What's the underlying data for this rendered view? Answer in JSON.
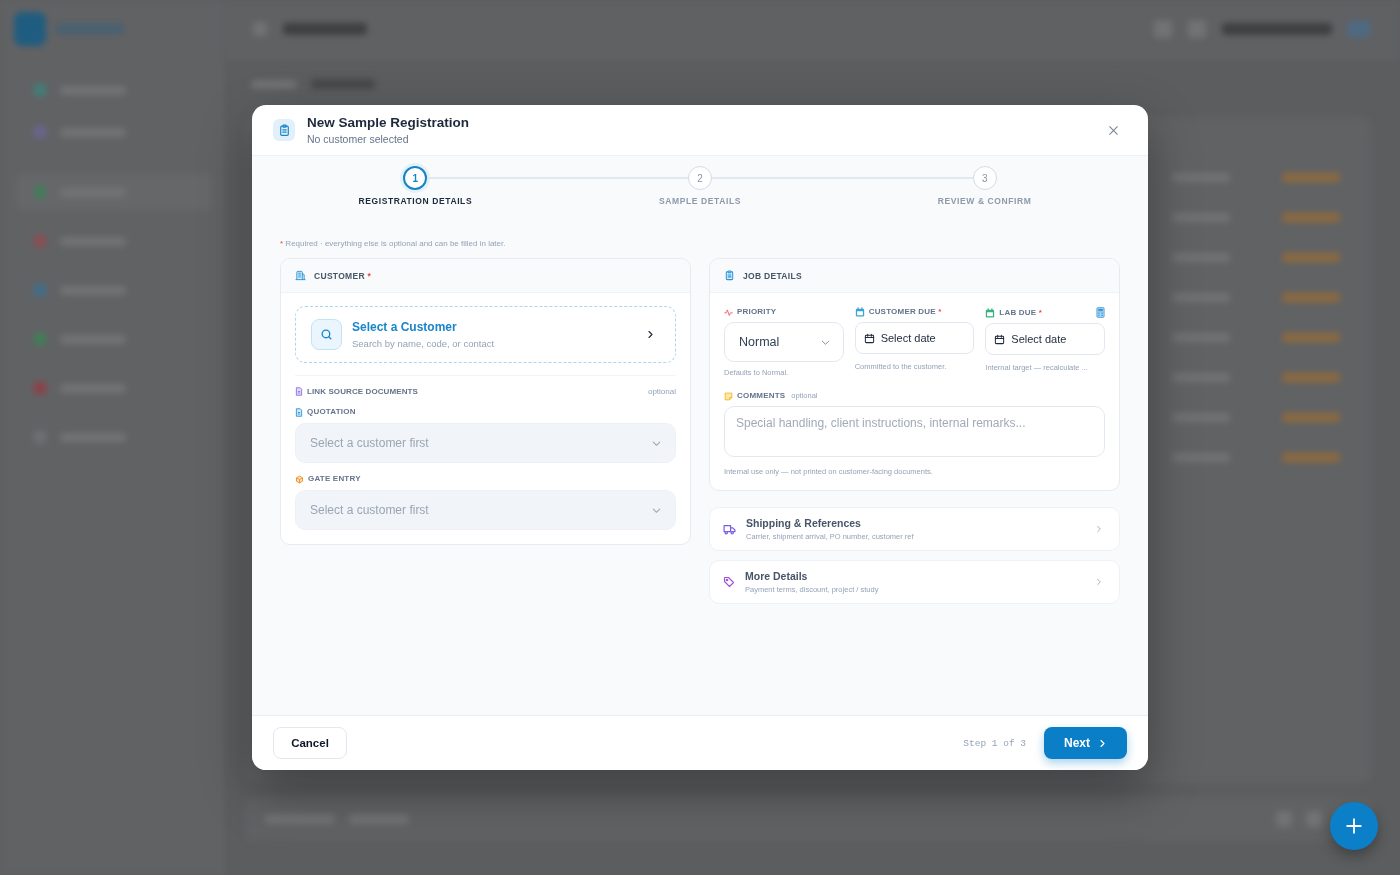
{
  "dialog": {
    "title": "New Sample Registration",
    "subtitle": "No customer selected"
  },
  "steps": [
    {
      "number": "1",
      "label": "REGISTRATION DETAILS",
      "selected": true
    },
    {
      "number": "2",
      "label": "SAMPLE DETAILS",
      "selected": false
    },
    {
      "number": "3",
      "label": "REVIEW & CONFIRM",
      "selected": false
    }
  ],
  "required_note": {
    "mark": "*",
    "text": "Required · everything else is optional and can be filled in later."
  },
  "customer_card": {
    "title": "CUSTOMER",
    "required_mark": "*",
    "picker": {
      "title": "Select a Customer",
      "hint": "Search by name, code, or contact"
    },
    "source_documents": {
      "title": "LINK SOURCE DOCUMENTS",
      "note": "optional"
    },
    "fields": [
      {
        "kind": "quotation",
        "label": "QUOTATION",
        "placeholder": "Select a customer first",
        "disabled": true
      },
      {
        "kind": "gate",
        "label": "GATE ENTRY",
        "placeholder": "Select a customer first",
        "disabled": true
      }
    ]
  },
  "job_card": {
    "title": "JOB DETAILS",
    "priority": {
      "label": "PRIORITY",
      "value": "Normal",
      "hint": "Defaults to Normal."
    },
    "dates": [
      {
        "kind": "customer",
        "label": "CUSTOMER DUE",
        "required_mark": "*",
        "color": "#3ba3dc",
        "placeholder": "Select date",
        "hint": "Committed to the customer."
      },
      {
        "kind": "lab",
        "label": "LAB DUE",
        "required_mark": "*",
        "color": "#36b37e",
        "placeholder": "Select date",
        "hint": "Internal target — recalculate ..."
      }
    ],
    "comments": {
      "label": "COMMENTS",
      "note": "optional",
      "placeholder": "Special handling, client instructions, internal remarks...",
      "hint": "Internal use only — not printed on customer-facing documents."
    }
  },
  "sections": [
    {
      "kind": "shipping",
      "title": "Shipping & References",
      "subtitle": "Carrier, shipment arrival, PO number, customer ref",
      "expanded": false
    },
    {
      "kind": "details",
      "title": "More Details",
      "subtitle": "Payment terms, discount, project / study",
      "expanded": false
    }
  ],
  "footer": {
    "cancel": "Cancel",
    "step_text": "Step 1 of 3",
    "next": "Next"
  }
}
